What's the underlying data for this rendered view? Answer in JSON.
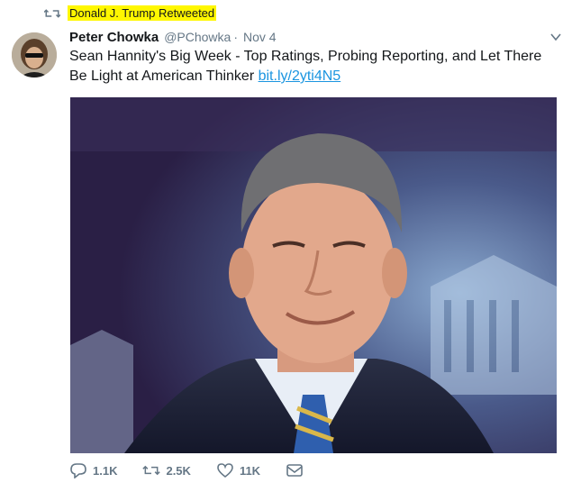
{
  "retweet": {
    "label": "Donald J. Trump Retweeted",
    "highlight_color": "#fff700"
  },
  "tweet": {
    "display_name": "Peter Chowka",
    "handle": "@PChowka",
    "separator": "·",
    "date": "Nov 4",
    "text": "Sean Hannity's Big Week - Top Ratings, Probing Reporting, and Let There Be Light at American Thinker ",
    "link": "bit.ly/2yti4N5",
    "link_color": "#1b95e0"
  },
  "actions": {
    "reply_count": "1.1K",
    "retweet_count": "2.5K",
    "like_count": "11K"
  },
  "icons": {
    "retweet": "retweet-icon",
    "caret": "chevron-down-icon",
    "reply": "reply-icon",
    "like": "heart-icon",
    "dm": "envelope-icon"
  }
}
